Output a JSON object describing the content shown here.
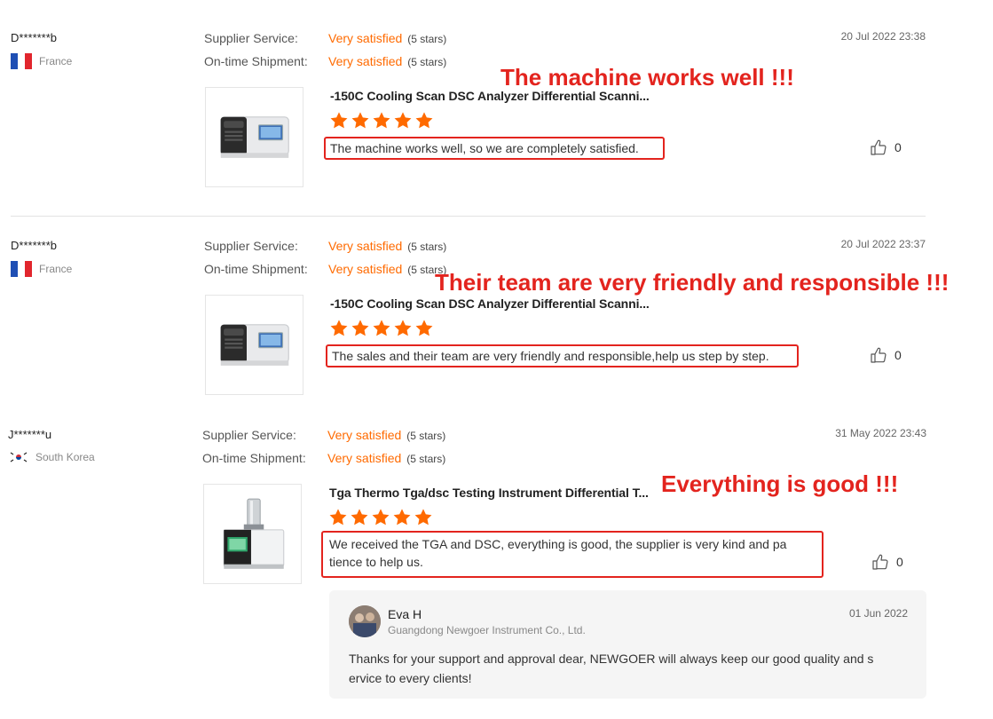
{
  "labels": {
    "supplier_service": "Supplier Service:",
    "on_time_shipment": "On-time Shipment:"
  },
  "colors": {
    "accent": "#ff6a00",
    "annotation_red": "#e3241e",
    "star": "#ff6a00"
  },
  "reviews": [
    {
      "name": "D*******b",
      "country": "France",
      "supplier_service": "Very satisfied",
      "supplier_service_stars": "(5 stars)",
      "shipment": "Very satisfied",
      "shipment_stars": "(5 stars)",
      "date": "20 Jul 2022 23:38",
      "product": "-150C Cooling Scan DSC Analyzer Differential Scanni...",
      "rating": 5,
      "comment": "The machine works well, so we are completely satisfied.",
      "likes": "0",
      "annotation": "The machine works well !!!"
    },
    {
      "name": "D*******b",
      "country": "France",
      "supplier_service": "Very satisfied",
      "supplier_service_stars": "(5 stars)",
      "shipment": "Very satisfied",
      "shipment_stars": "(5 stars)",
      "date": "20 Jul 2022 23:37",
      "product": "-150C Cooling Scan DSC Analyzer Differential Scanni...",
      "rating": 5,
      "comment": "The sales and their team are very friendly and responsible,help us step by step.",
      "likes": "0",
      "annotation": "Their team are very friendly and responsible !!!"
    },
    {
      "name": "J*******u",
      "country": "South Korea",
      "supplier_service": "Very satisfied",
      "supplier_service_stars": "(5 stars)",
      "shipment": "Very satisfied",
      "shipment_stars": "(5 stars)",
      "date": "31 May 2022 23:43",
      "product": "Tga Thermo Tga/dsc Testing Instrument Differential T...",
      "rating": 5,
      "comment_line1": "We received the TGA and DSC, everything is good, the supplier is very kind and pa",
      "comment_line2": "tience to help us.",
      "likes": "0",
      "annotation": "Everything is good !!!",
      "reply": {
        "name": "Eva H",
        "company": "Guangdong Newgoer Instrument Co., Ltd.",
        "date": "01 Jun 2022",
        "text_line1": "Thanks for your support and approval dear, NEWGOER will always keep our good quality and s",
        "text_line2": "ervice to every clients!"
      }
    }
  ]
}
